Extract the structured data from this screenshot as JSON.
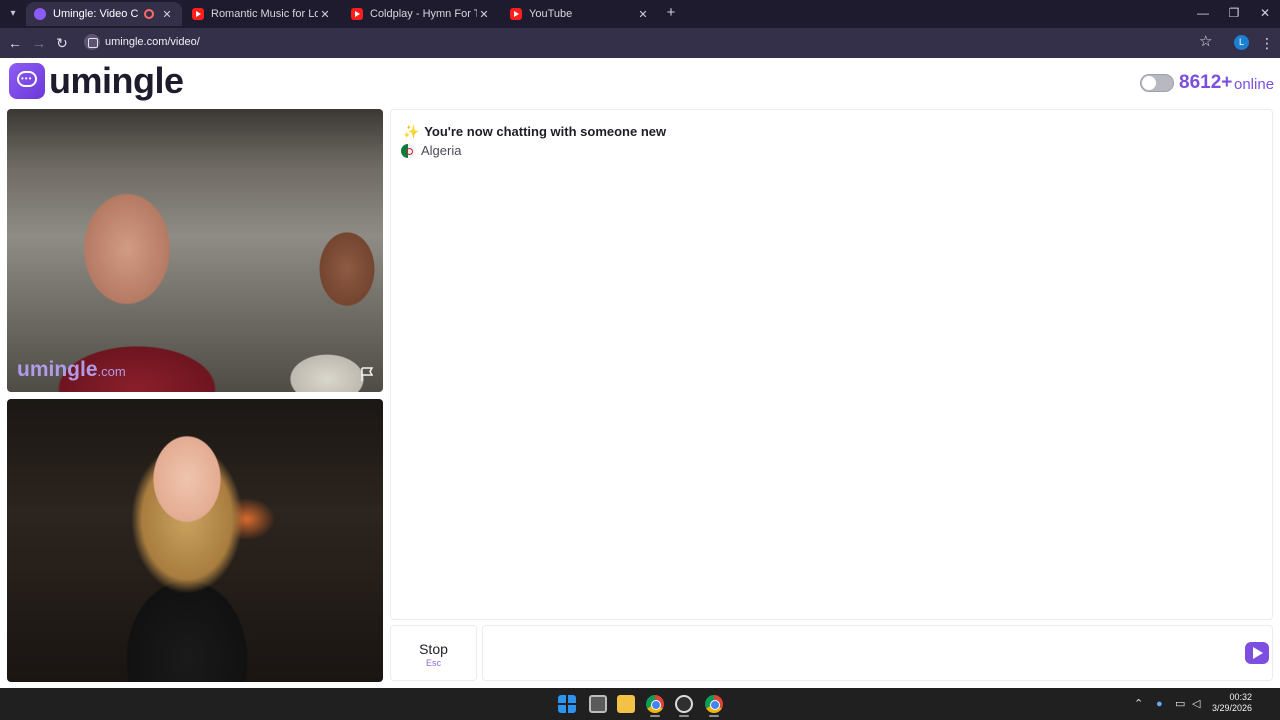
{
  "browser": {
    "tabs": [
      {
        "label": "Umingle: Video Chat with S",
        "active": true,
        "recording": true
      },
      {
        "label": "Romantic Music for Love Night",
        "active": false
      },
      {
        "label": "Coldplay - Hymn For The Week",
        "active": false
      },
      {
        "label": "YouTube",
        "active": false
      }
    ],
    "url": "umingle.com/video/",
    "profile_initial": "L"
  },
  "header": {
    "logo_text": "umingle",
    "online_count": "8612+",
    "online_label": "online",
    "toggle_on": false
  },
  "video_remote": {
    "watermark": "umingle",
    "watermark_suffix": ".com"
  },
  "chat": {
    "status_message": "You're now chatting with someone new",
    "country": "Algeria",
    "input_value": "",
    "input_placeholder": ""
  },
  "controls": {
    "stop_label": "Stop",
    "stop_shortcut": "Esc"
  },
  "taskbar": {
    "time": "00:32",
    "date": "3/29/2026"
  },
  "colors": {
    "brand": "#7c4fe0",
    "tab_bar": "#1f1b2e",
    "toolbar": "#35304a"
  }
}
